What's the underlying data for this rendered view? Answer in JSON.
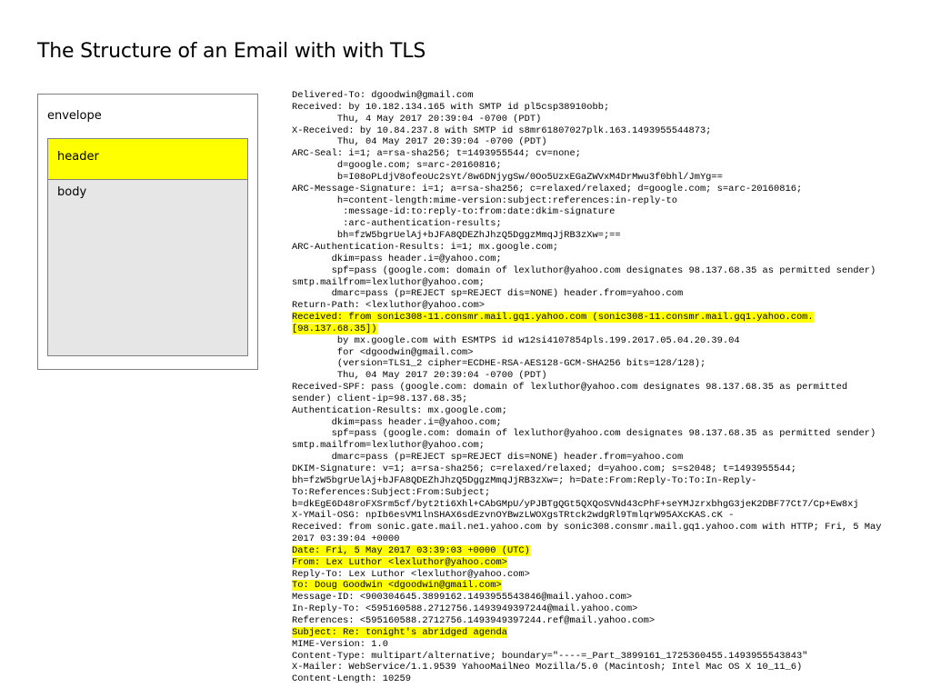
{
  "title": "The Structure of an Email with with TLS",
  "diagram": {
    "envelope_label": "envelope",
    "header_label": "header",
    "body_label": "body",
    "colors": {
      "highlight": "#ffff00",
      "body_fill": "#e6e6e6",
      "border": "#7f7f7f"
    }
  },
  "raw_lines": [
    {
      "text": "Delivered-To: dgoodwin@gmail.com",
      "hl": false
    },
    {
      "text": "Received: by 10.182.134.165 with SMTP id pl5csp38910obb;",
      "hl": false
    },
    {
      "text": "        Thu, 4 May 2017 20:39:04 -0700 (PDT)",
      "hl": false
    },
    {
      "text": "X-Received: by 10.84.237.8 with SMTP id s8mr61807027plk.163.1493955544873;",
      "hl": false
    },
    {
      "text": "        Thu, 04 May 2017 20:39:04 -0700 (PDT)",
      "hl": false
    },
    {
      "text": "ARC-Seal: i=1; a=rsa-sha256; t=1493955544; cv=none;",
      "hl": false
    },
    {
      "text": "        d=google.com; s=arc-20160816;",
      "hl": false
    },
    {
      "text": "        b=I08oPLdjV8ofeoUc2sYt/8w6DNjygSw/0Oo5UzxEGaZWVxM4DrMwu3f0bhl/JmYg==",
      "hl": false
    },
    {
      "text": "ARC-Message-Signature: i=1; a=rsa-sha256; c=relaxed/relaxed; d=google.com; s=arc-20160816;",
      "hl": false
    },
    {
      "text": "        h=content-length:mime-version:subject:references:in-reply-to",
      "hl": false
    },
    {
      "text": "         :message-id:to:reply-to:from:date:dkim-signature",
      "hl": false
    },
    {
      "text": "         :arc-authentication-results;",
      "hl": false
    },
    {
      "text": "        bh=fzW5bgrUelAj+bJFA8QDEZhJhzQ5DggzMmqJjRB3zXw=;==",
      "hl": false
    },
    {
      "text": "ARC-Authentication-Results: i=1; mx.google.com;",
      "hl": false
    },
    {
      "text": "       dkim=pass header.i=@yahoo.com;",
      "hl": false
    },
    {
      "text": "       spf=pass (google.com: domain of lexluthor@yahoo.com designates 98.137.68.35 as permitted sender)",
      "hl": false
    },
    {
      "text": "smtp.mailfrom=lexluthor@yahoo.com;",
      "hl": false
    },
    {
      "text": "       dmarc=pass (p=REJECT sp=REJECT dis=NONE) header.from=yahoo.com",
      "hl": false
    },
    {
      "text": "Return-Path: <lexluthor@yahoo.com>",
      "hl": false
    },
    {
      "text": "Received: from sonic308-11.consmr.mail.gq1.yahoo.com (sonic308-11.consmr.mail.gq1.yahoo.com.",
      "hl": true
    },
    {
      "text": "[98.137.68.35])",
      "hl": true
    },
    {
      "text": "        by mx.google.com with ESMTPS id w12si4107854pls.199.2017.05.04.20.39.04",
      "hl": false
    },
    {
      "text": "        for <dgoodwin@gmail.com>",
      "hl": false
    },
    {
      "text": "        (version=TLS1_2 cipher=ECDHE-RSA-AES128-GCM-SHA256 bits=128/128);",
      "hl": false
    },
    {
      "text": "        Thu, 04 May 2017 20:39:04 -0700 (PDT)",
      "hl": false
    },
    {
      "text": "Received-SPF: pass (google.com: domain of lexluthor@yahoo.com designates 98.137.68.35 as permitted",
      "hl": false
    },
    {
      "text": "sender) client-ip=98.137.68.35;",
      "hl": false
    },
    {
      "text": "Authentication-Results: mx.google.com;",
      "hl": false
    },
    {
      "text": "       dkim=pass header.i=@yahoo.com;",
      "hl": false
    },
    {
      "text": "       spf=pass (google.com: domain of lexluthor@yahoo.com designates 98.137.68.35 as permitted sender)",
      "hl": false
    },
    {
      "text": "smtp.mailfrom=lexluthor@yahoo.com;",
      "hl": false
    },
    {
      "text": "       dmarc=pass (p=REJECT sp=REJECT dis=NONE) header.from=yahoo.com",
      "hl": false
    },
    {
      "text": "DKIM-Signature: v=1; a=rsa-sha256; c=relaxed/relaxed; d=yahoo.com; s=s2048; t=1493955544;",
      "hl": false
    },
    {
      "text": "bh=fzW5bgrUelAj+bJFA8QDEZhJhzQ5DggzMmqJjRB3zXw=; h=Date:From:Reply-To:To:In-Reply-",
      "hl": false
    },
    {
      "text": "To:References:Subject:From:Subject;",
      "hl": false
    },
    {
      "text": "b=dkEgE6D48roFXSrm5cf/byt2ti6Xhl+CAbGMpU/yPJBTgQGt5QXQoSVNd43cPhF+seYMJzrxbhgG3jeK2DBF77Ct7/Cp+Ew8xj",
      "hl": false
    },
    {
      "text": "X-YMail-OSG: npIb6esVM1lnSHAX6sdEzvnOYBwzLWOXgsTRtck2wdgRl9TmlqrW95AXcKAS.cK -",
      "hl": false
    },
    {
      "text": "Received: from sonic.gate.mail.ne1.yahoo.com by sonic308.consmr.mail.gq1.yahoo.com with HTTP; Fri, 5 May",
      "hl": false
    },
    {
      "text": "2017 03:39:04 +0000",
      "hl": false
    },
    {
      "text": "Date: Fri, 5 May 2017 03:39:03 +0000 (UTC)",
      "hl": true
    },
    {
      "text": "From: Lex Luthor <lexluthor@yahoo.com>",
      "hl": true
    },
    {
      "text": "Reply-To: Lex Luthor <lexluthor@yahoo.com>",
      "hl": false
    },
    {
      "text": "To: Doug Goodwin <dgoodwin@gmail.com>",
      "hl": true
    },
    {
      "text": "Message-ID: <900304645.3899162.1493955543846@mail.yahoo.com>",
      "hl": false
    },
    {
      "text": "In-Reply-To: <595160588.2712756.1493949397244@mail.yahoo.com>",
      "hl": false
    },
    {
      "text": "References: <595160588.2712756.1493949397244.ref@mail.yahoo.com>",
      "hl": false
    },
    {
      "text": "Subject: Re: tonight's abridged agenda",
      "hl": true
    },
    {
      "text": "MIME-Version: 1.0",
      "hl": false
    },
    {
      "text": "Content-Type: multipart/alternative; boundary=\"----=_Part_3899161_1725360455.1493955543843\"",
      "hl": false
    },
    {
      "text": "X-Mailer: WebService/1.1.9539 YahooMailNeo Mozilla/5.0 (Macintosh; Intel Mac OS X 10_11_6)",
      "hl": false
    },
    {
      "text": "Content-Length: 10259",
      "hl": false
    }
  ]
}
